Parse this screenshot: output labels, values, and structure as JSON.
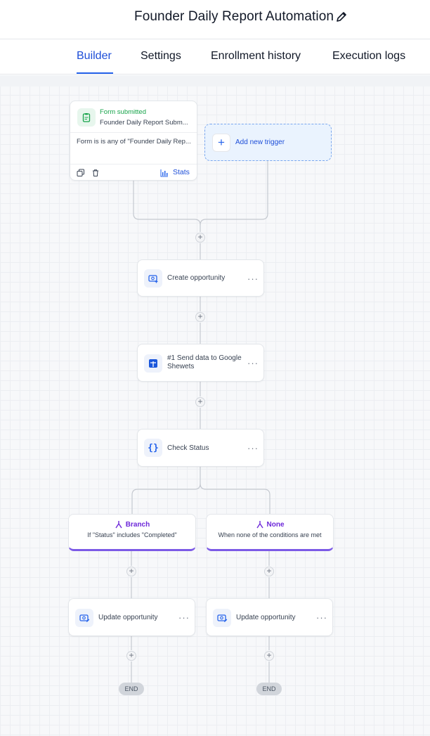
{
  "header": {
    "title": "Founder Daily Report Automation",
    "edit_icon": "pencil-icon"
  },
  "tabs": [
    {
      "label": "Builder",
      "active": true
    },
    {
      "label": "Settings",
      "active": false
    },
    {
      "label": "Enrollment history",
      "active": false
    },
    {
      "label": "Execution logs",
      "active": false
    }
  ],
  "trigger": {
    "title": "Form submitted",
    "subtitle": "Founder Daily Report Subm...",
    "condition": "Form is is any of \"Founder Daily Rep...",
    "stats_label": "Stats",
    "icon": "clipboard-icon"
  },
  "add_trigger": {
    "label": "Add new trigger"
  },
  "actions": [
    {
      "label": "Create opportunity",
      "icon": "opportunity-add-icon"
    },
    {
      "label": "#1 Send data to Google Shewets",
      "icon": "google-sheets-icon"
    },
    {
      "label": "Check Status",
      "icon": "code-braces-icon"
    }
  ],
  "branches": [
    {
      "title": "Branch",
      "subtitle": "If \"Status\" includes \"Completed\"",
      "action": "Update opportunity",
      "end": "END"
    },
    {
      "title": "None",
      "subtitle": "When none of the conditions are met",
      "action": "Update opportunity",
      "end": "END"
    }
  ],
  "colors": {
    "accent": "#2563eb",
    "branch": "#7c5ae6",
    "trigger_green": "#16a34a"
  }
}
